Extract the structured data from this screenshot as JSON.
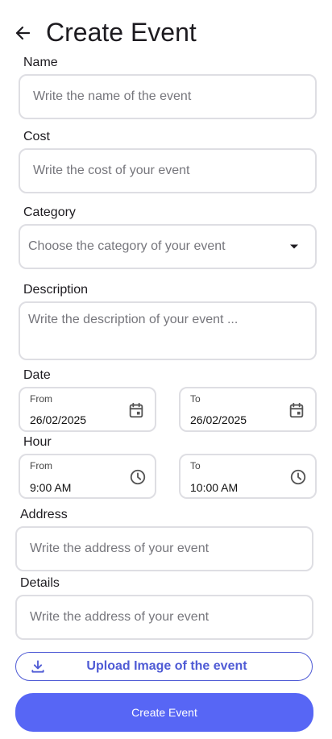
{
  "header": {
    "title": "Create Event"
  },
  "name": {
    "label": "Name",
    "placeholder": "Write the name of the event"
  },
  "cost": {
    "label": "Cost",
    "placeholder": "Write the cost of your event"
  },
  "category": {
    "label": "Category",
    "placeholder": "Choose the category of your event"
  },
  "description": {
    "label": "Description",
    "placeholder": "Write the description of your event ..."
  },
  "date": {
    "label": "Date",
    "from_label": "From",
    "from_value": "26/02/2025",
    "to_label": "To",
    "to_value": "26/02/2025"
  },
  "hour": {
    "label": "Hour",
    "from_label": "From",
    "from_value": "9:00 AM",
    "to_label": "To",
    "to_value": "10:00 AM"
  },
  "address": {
    "label": "Address",
    "placeholder": "Write the address of your event"
  },
  "details": {
    "label": "Details",
    "placeholder": "Write the address of your event"
  },
  "upload": {
    "label": "Upload Image of the event"
  },
  "submit": {
    "label": "Create Event"
  },
  "colors": {
    "primary": "#5766f5",
    "outline_accent": "#4f5bd5",
    "field_border": "#dedee3"
  }
}
